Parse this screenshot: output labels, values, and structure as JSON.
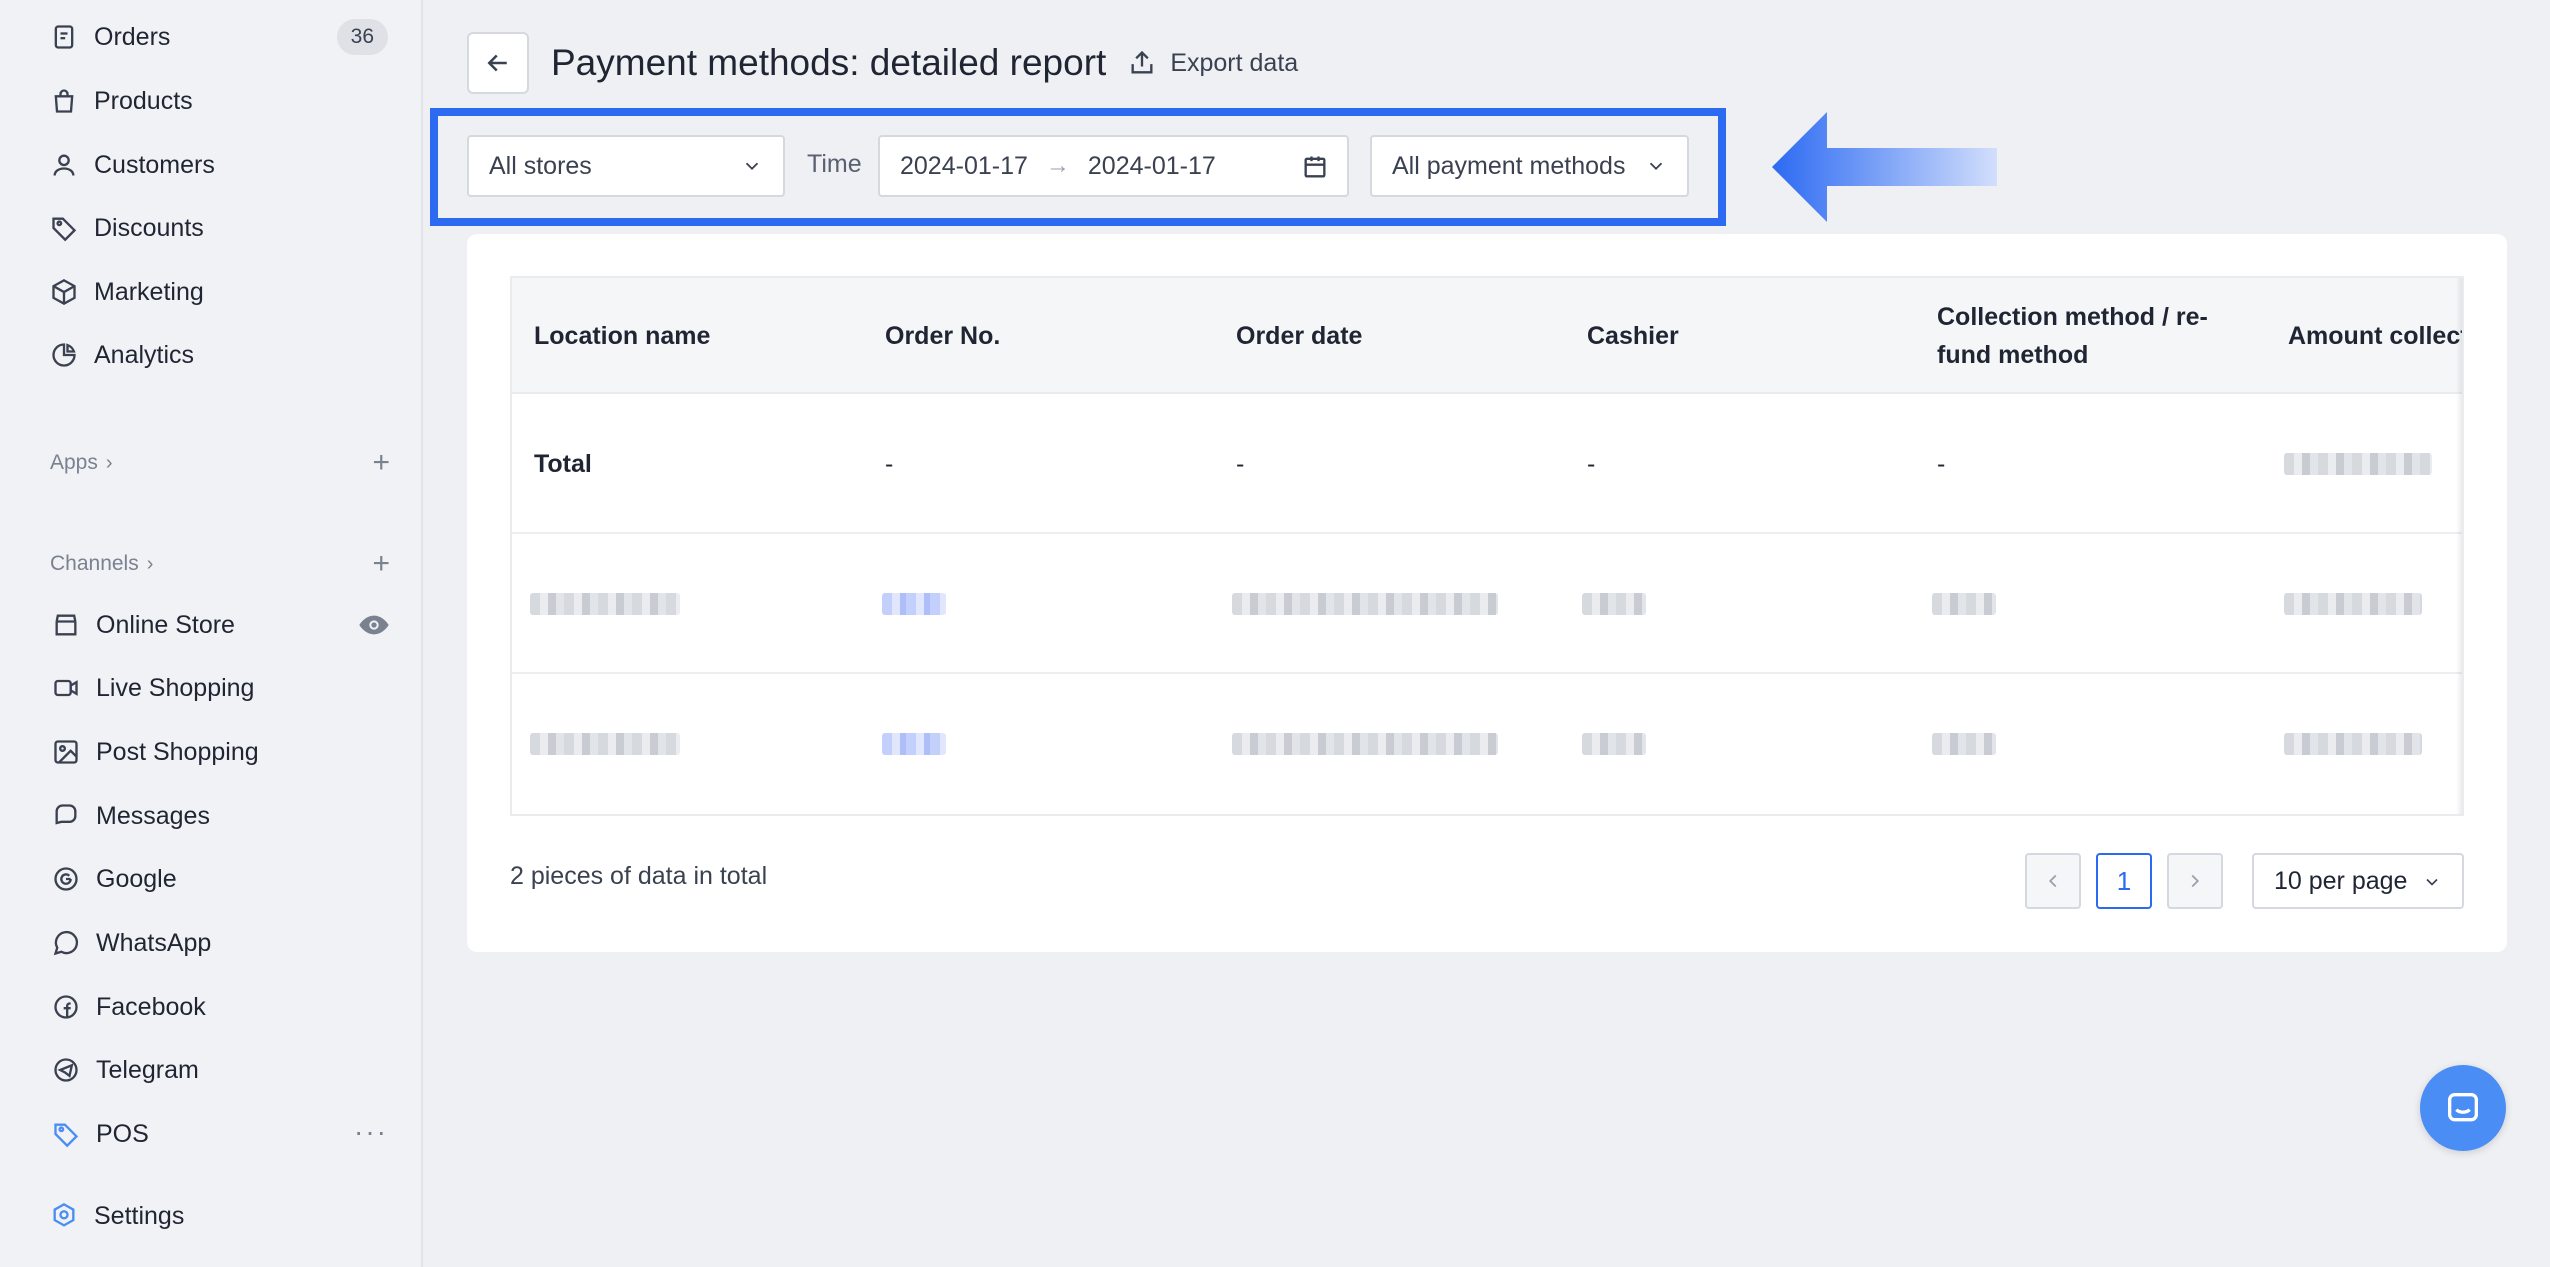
{
  "sidebar": {
    "items": [
      {
        "label": "Orders",
        "icon": "orders-icon",
        "badge": "36"
      },
      {
        "label": "Products",
        "icon": "bag-icon"
      },
      {
        "label": "Customers",
        "icon": "person-icon"
      },
      {
        "label": "Discounts",
        "icon": "tag-icon"
      },
      {
        "label": "Marketing",
        "icon": "cube-icon"
      },
      {
        "label": "Analytics",
        "icon": "pie-chart-icon"
      }
    ],
    "apps_label": "Apps",
    "channels_label": "Channels",
    "channels": [
      {
        "label": "Online Store",
        "icon": "store-icon"
      },
      {
        "label": "Live Shopping",
        "icon": "video-icon"
      },
      {
        "label": "Post Shopping",
        "icon": "image-icon"
      },
      {
        "label": "Messages",
        "icon": "chat-icon"
      },
      {
        "label": "Google",
        "icon": "google-icon"
      },
      {
        "label": "WhatsApp",
        "icon": "whatsapp-icon"
      },
      {
        "label": "Facebook",
        "icon": "facebook-icon"
      },
      {
        "label": "Telegram",
        "icon": "telegram-icon"
      },
      {
        "label": "POS",
        "icon": "pos-tag-icon"
      }
    ],
    "settings_label": "Settings"
  },
  "header": {
    "title": "Payment methods: detailed report",
    "export_label": "Export data"
  },
  "filters": {
    "store": "All stores",
    "time_label": "Time",
    "date_start": "2024-01-17",
    "date_sep": "→",
    "date_end": "2024-01-17",
    "payment": "All payment methods"
  },
  "table": {
    "columns": [
      "Location name",
      "Order No.",
      "Order date",
      "Cashier",
      "Collection method / re-fund method",
      "Amount collect"
    ],
    "total_row": [
      "Total",
      "-",
      "-",
      "-",
      "-"
    ]
  },
  "footer": {
    "total_text": "2 pieces of data in total",
    "current_page": "1",
    "per_page": "10 per page"
  },
  "colors": {
    "accent": "#2c6af2",
    "highlight_box": "#2c6af2",
    "chat_button": "#4a8df5"
  }
}
